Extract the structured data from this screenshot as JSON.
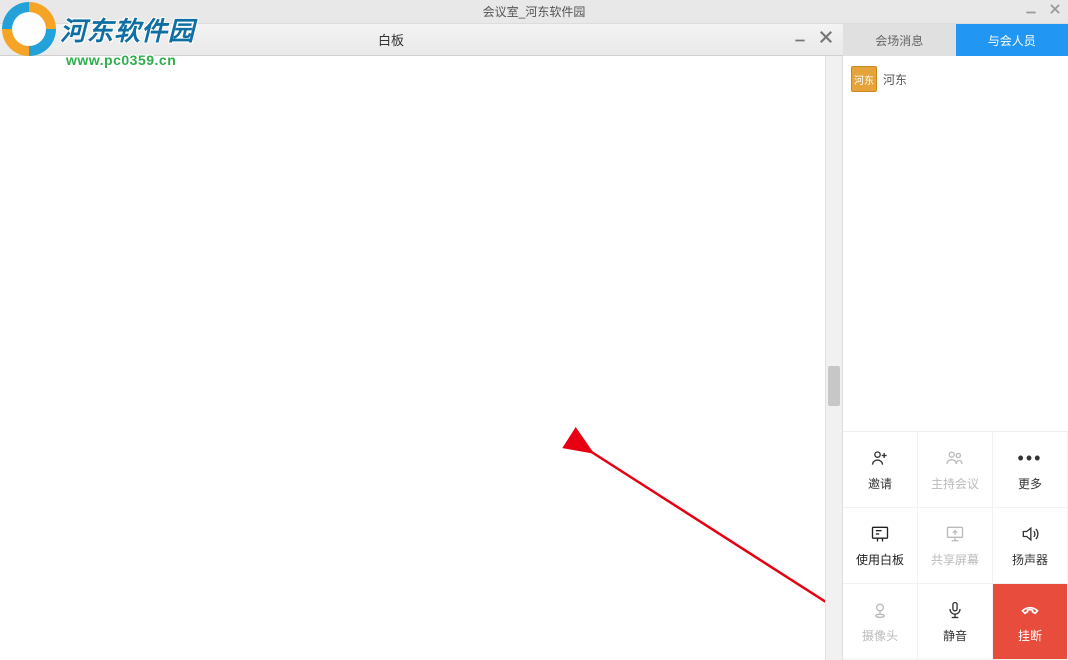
{
  "main_window": {
    "title": "会议室_河东软件园"
  },
  "whiteboard_window": {
    "title": "白板"
  },
  "watermark": {
    "name": "河东软件园",
    "url": "www.pc0359.cn"
  },
  "tabs": {
    "messages": "会场消息",
    "participants": "与会人员",
    "active": "participants"
  },
  "participants": [
    {
      "avatar_text": "河东",
      "name": "河东"
    }
  ],
  "actions": {
    "invite": "邀请",
    "host": "主持会议",
    "more": "更多",
    "whiteboard": "使用白板",
    "share": "共享屏幕",
    "speaker": "扬声器",
    "camera": "摄像头",
    "mute": "静音",
    "hangup": "挂断"
  },
  "icons": {
    "invite": "person-plus-icon",
    "host": "people-icon",
    "more": "more-icon",
    "whiteboard": "whiteboard-icon",
    "share": "share-screen-icon",
    "speaker": "speaker-icon",
    "camera": "camera-icon",
    "mute": "microphone-icon",
    "hangup": "phone-hangup-icon"
  }
}
